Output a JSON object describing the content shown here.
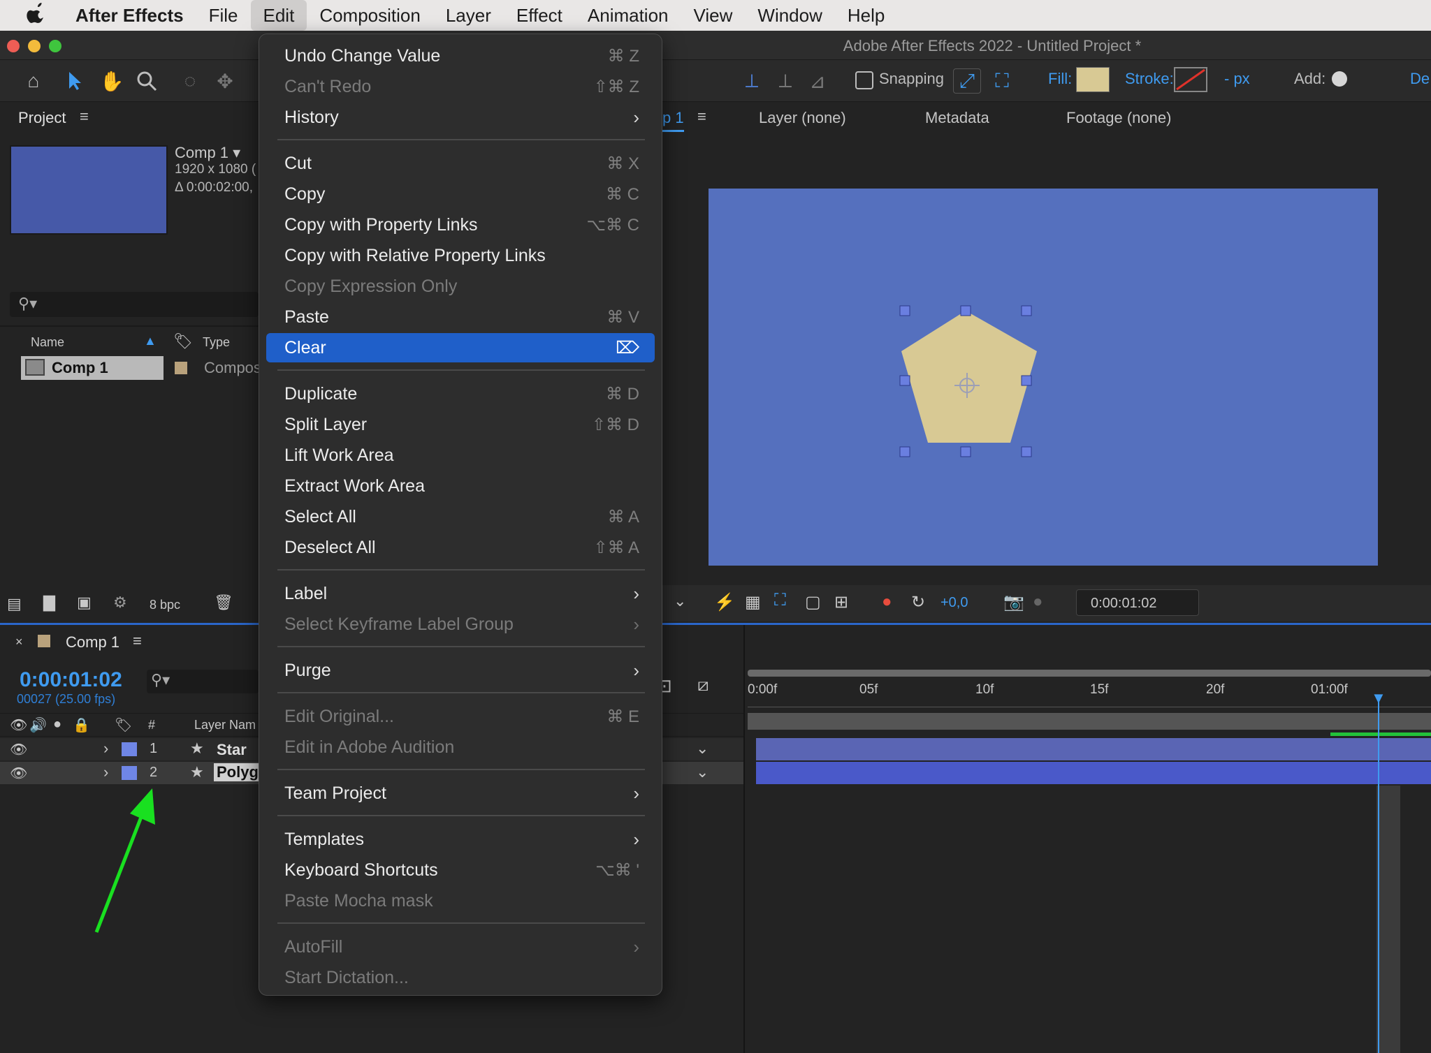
{
  "menubar": {
    "app": "After Effects",
    "items": [
      "File",
      "Edit",
      "Composition",
      "Layer",
      "Effect",
      "Animation",
      "View",
      "Window",
      "Help"
    ]
  },
  "window": {
    "title": "Adobe After Effects 2022 - Untitled Project *"
  },
  "toolbar": {
    "snapping": "Snapping",
    "fill": "Fill:",
    "stroke": "Stroke:",
    "px": "- px",
    "add": "Add:",
    "workspace": "De",
    "fill_color": "#d8c994"
  },
  "project": {
    "tab": "Project",
    "comp_name": "Comp 1 ▾",
    "comp_size": "1920 x 1080 (",
    "comp_duration": "Δ 0:00:02:00,",
    "col_name": "Name",
    "col_type": "Type",
    "item_name": "Comp 1",
    "item_type": "Compos",
    "bpc": "8 bpc",
    "thumb_color": "#4659a8"
  },
  "viewer_tabs": {
    "comp": "p 1",
    "layer": "Layer (none)",
    "metadata": "Metadata",
    "footage": "Footage (none)"
  },
  "viewer": {
    "bg_color": "#5570be",
    "shape_color": "#d8c994",
    "exposure": "+0,0",
    "timecode": "0:00:01:02"
  },
  "timeline": {
    "tab": "Comp 1",
    "timecode": "0:00:01:02",
    "frames": "00027 (25.00 fps)",
    "col_hash": "#",
    "col_layer": "Layer Nam",
    "layers": [
      {
        "num": "1",
        "name": "Star"
      },
      {
        "num": "2",
        "name": "Polyg"
      }
    ],
    "ruler": [
      "0:00f",
      "05f",
      "10f",
      "15f",
      "20f",
      "01:00f"
    ]
  },
  "edit_menu": {
    "items": [
      {
        "label": "Undo Change Value",
        "shortcut": "⌘ Z",
        "disabled": false
      },
      {
        "label": "Can't Redo",
        "shortcut": "⇧⌘ Z",
        "disabled": true
      },
      {
        "label": "History",
        "submenu": true,
        "disabled": false
      },
      {
        "label": "Cut",
        "shortcut": "⌘ X",
        "disabled": false
      },
      {
        "label": "Copy",
        "shortcut": "⌘ C",
        "disabled": false
      },
      {
        "label": "Copy with Property Links",
        "shortcut": "⌥⌘ C",
        "disabled": false
      },
      {
        "label": "Copy with Relative Property Links",
        "disabled": false
      },
      {
        "label": "Copy Expression Only",
        "disabled": true
      },
      {
        "label": "Paste",
        "shortcut": "⌘ V",
        "disabled": false
      },
      {
        "label": "Clear",
        "shortcut": "⌦",
        "disabled": false,
        "highlighted": true
      },
      {
        "label": "Duplicate",
        "shortcut": "⌘ D",
        "disabled": false
      },
      {
        "label": "Split Layer",
        "shortcut": "⇧⌘ D",
        "disabled": false
      },
      {
        "label": "Lift Work Area",
        "disabled": false
      },
      {
        "label": "Extract Work Area",
        "disabled": false
      },
      {
        "label": "Select All",
        "shortcut": "⌘ A",
        "disabled": false
      },
      {
        "label": "Deselect All",
        "shortcut": "⇧⌘ A",
        "disabled": false
      },
      {
        "label": "Label",
        "submenu": true,
        "disabled": false
      },
      {
        "label": "Select Keyframe Label Group",
        "submenu": true,
        "disabled": true
      },
      {
        "label": "Purge",
        "submenu": true,
        "disabled": false
      },
      {
        "label": "Edit Original...",
        "shortcut": "⌘ E",
        "disabled": true
      },
      {
        "label": "Edit in Adobe Audition",
        "disabled": true
      },
      {
        "label": "Team Project",
        "submenu": true,
        "disabled": false
      },
      {
        "label": "Templates",
        "submenu": true,
        "disabled": false
      },
      {
        "label": "Keyboard Shortcuts",
        "shortcut": "⌥⌘ '",
        "disabled": false
      },
      {
        "label": "Paste Mocha mask",
        "disabled": true
      },
      {
        "label": "AutoFill",
        "submenu": true,
        "disabled": true
      },
      {
        "label": "Start Dictation...",
        "disabled": true
      }
    ]
  },
  "colors": {
    "accent": "#1f5fc9",
    "timecode_blue": "#3f9bf0",
    "arrow": "#19e020",
    "layer_label": "#6f86e6"
  }
}
